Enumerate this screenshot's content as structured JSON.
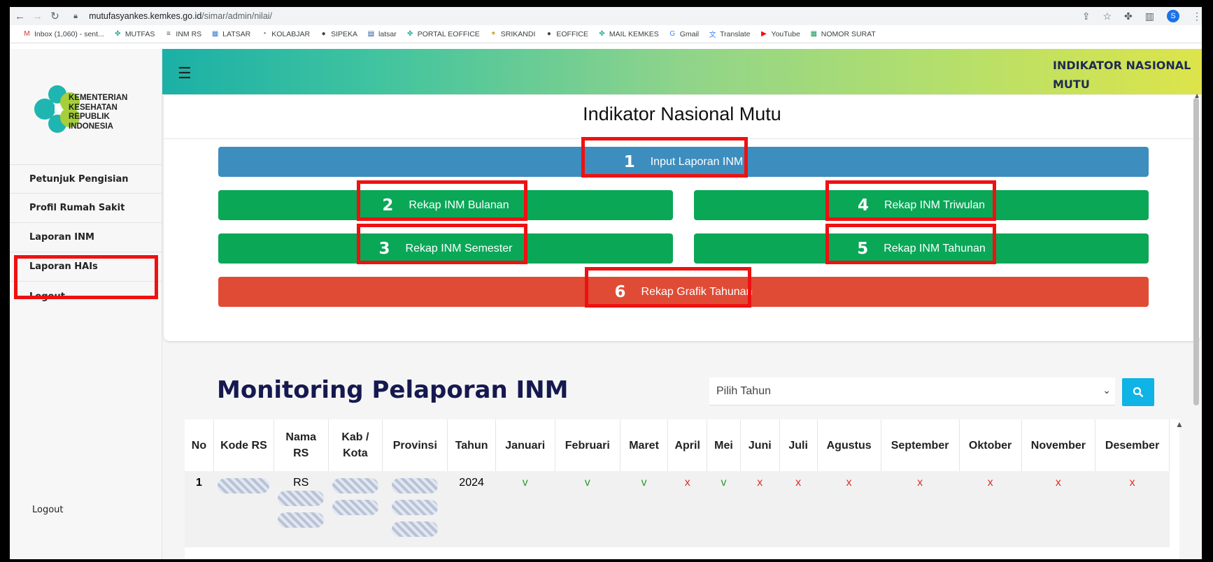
{
  "browser": {
    "url_host": "mutufasyankes.kemkes.go.id",
    "url_path": "/simar/admin/nilai/",
    "profile_initial": "S"
  },
  "bookmarks": [
    {
      "label": "Inbox (1,060) - sent...",
      "icon": "gmail-icon",
      "color": "#d93025"
    },
    {
      "label": "MUTFAS",
      "icon": "kemkes-icon",
      "color": "#2ab0a0"
    },
    {
      "label": "INM RS",
      "icon": "inm-icon",
      "color": "#555555"
    },
    {
      "label": "LATSAR",
      "icon": "grid-icon",
      "color": "#3a7bd5"
    },
    {
      "label": "KOLABJAR",
      "icon": "kolabjar-icon",
      "color": "#555555"
    },
    {
      "label": "SIPEKA",
      "icon": "globe-icon",
      "color": "#444444"
    },
    {
      "label": "latsar",
      "icon": "doc-icon",
      "color": "#1a4f9c"
    },
    {
      "label": "PORTAL EOFFICE",
      "icon": "kemkes-icon",
      "color": "#2ab0a0"
    },
    {
      "label": "SRIKANDI",
      "icon": "srikandi-icon",
      "color": "#c99a1b"
    },
    {
      "label": "EOFFICE",
      "icon": "globe-icon",
      "color": "#444444"
    },
    {
      "label": "MAIL KEMKES",
      "icon": "kemkes-icon",
      "color": "#2ab0a0"
    },
    {
      "label": "Gmail",
      "icon": "google-icon",
      "color": "#4285f4"
    },
    {
      "label": "Translate",
      "icon": "translate-icon",
      "color": "#4285f4"
    },
    {
      "label": "YouTube",
      "icon": "youtube-icon",
      "color": "#ff0000"
    },
    {
      "label": "NOMOR SURAT",
      "icon": "sheet-icon",
      "color": "#0f9d58"
    }
  ],
  "logo": {
    "line1": "KEMENTERIAN",
    "line2": "KESEHATAN",
    "line3": "REPUBLIK",
    "line4": "INDONESIA"
  },
  "sidebar": {
    "items": [
      {
        "label": "Petunjuk Pengisian"
      },
      {
        "label": "Profil Rumah Sakit"
      },
      {
        "label": "Laporan INM"
      },
      {
        "label": "Laporan HAIs"
      },
      {
        "label": "Logout"
      }
    ],
    "bottom_logout": "Logout"
  },
  "header": {
    "title_line1": "INDIKATOR NASIONAL",
    "title_line2": "MUTU"
  },
  "card": {
    "title": "Indikator Nasional Mutu",
    "buttons": [
      {
        "num": "1",
        "label": "Input Laporan INM",
        "color": "#3d8ebf"
      },
      {
        "num": "2",
        "label": "Rekap INM Bulanan",
        "color": "#0aa757"
      },
      {
        "num": "4",
        "label": "Rekap INM Triwulan",
        "color": "#0aa757"
      },
      {
        "num": "3",
        "label": "Rekap INM Semester",
        "color": "#0aa757"
      },
      {
        "num": "5",
        "label": "Rekap INM Tahunan",
        "color": "#0aa757"
      },
      {
        "num": "6",
        "label": "Rekap Grafik Tahunan",
        "color": "#e04b35"
      }
    ]
  },
  "monitoring": {
    "title": "Monitoring Pelaporan INM",
    "year_placeholder": "Pilih Tahun",
    "columns": [
      "No",
      "Kode RS",
      "Nama RS",
      "Kab / Kota",
      "Provinsi",
      "Tahun",
      "Januari",
      "Februari",
      "Maret",
      "April",
      "Mei",
      "Juni",
      "Juli",
      "Agustus",
      "September",
      "Oktober",
      "November",
      "Desember"
    ],
    "rows": [
      {
        "no": "1",
        "nama_prefix": "RS",
        "tahun": "2024",
        "months": [
          "v",
          "v",
          "v",
          "x",
          "v",
          "x",
          "x",
          "x",
          "x",
          "x",
          "x",
          "x"
        ]
      }
    ]
  },
  "colors": {
    "highlight": "#ee1111",
    "check": "#2e9a2e",
    "cross": "#e22b2b"
  }
}
